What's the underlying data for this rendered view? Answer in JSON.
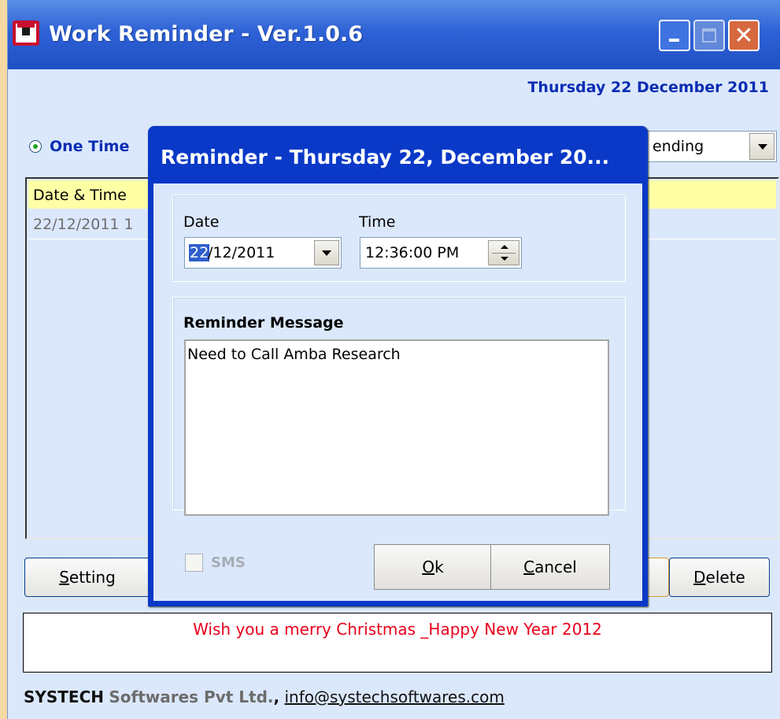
{
  "main": {
    "title": "Work Reminder - Ver.1.0.6",
    "date_header": "Thursday 22 December 2011",
    "radio_onetime": "One Time",
    "sort_select_value": "ending",
    "list": {
      "header_col1": "Date & Time",
      "row1": "22/12/2011 1"
    },
    "buttons": {
      "setting_u": "S",
      "setting_rest": "etting",
      "delete_u": "D",
      "delete_rest": "elete"
    },
    "message": "Wish you a merry Christmas _Happy New Year 2012",
    "footer": {
      "company": "SYSTECH",
      "company2": "Softwares Pvt Ltd.",
      "comma": ",",
      "email": "info@systechsoftwares.com"
    }
  },
  "dialog": {
    "title": "Reminder - Thursday 22,  December 20...",
    "date_label": "Date",
    "time_label": "Time",
    "date_selected": "22",
    "date_rest": "/12/2011",
    "time_value": "12:36:00 PM",
    "message_label": "Reminder Message",
    "message_value": "Need to Call Amba Research",
    "sms_label": "SMS",
    "ok_u": "O",
    "ok_rest": "k",
    "cancel_u": "C",
    "cancel_rest": "ancel"
  },
  "colors": {
    "titlebar": "#2e62d6",
    "window_bg": "#dbe8fb",
    "accent_text": "#0b2db3",
    "message_text": "#e8001c",
    "list_header": "#ffffa6"
  }
}
